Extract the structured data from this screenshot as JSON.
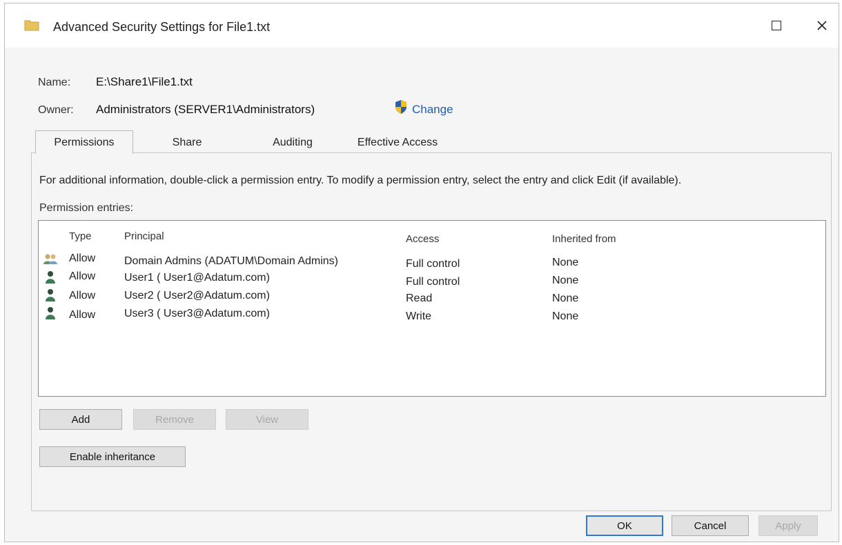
{
  "window": {
    "title": "Advanced Security Settings for File1.txt"
  },
  "fields": {
    "name_label": "Name:",
    "name_value": "E:\\Share1\\File1.txt",
    "owner_label": "Owner:",
    "owner_value": "Administrators (SERVER1\\Administrators)",
    "change_label": "Change"
  },
  "tabs": [
    {
      "label": "Permissions",
      "active": true
    },
    {
      "label": "Share"
    },
    {
      "label": "Auditing"
    },
    {
      "label": "Effective Access"
    }
  ],
  "info_text": "For additional information, double-click a permission entry. To modify a permission entry, select the entry and click Edit (if available).",
  "entries_label": "Permission entries:",
  "columns": {
    "type": "Type",
    "principal": "Principal",
    "access": "Access",
    "inherited": "Inherited from"
  },
  "entries": [
    {
      "icon": "group-users-icon",
      "type": "Allow",
      "principal": "Domain Admins (ADATUM\\Domain Admins)",
      "access": "Full control",
      "inherited": "None"
    },
    {
      "icon": "user-icon",
      "type": "Allow",
      "principal": "User1 ( User1@Adatum.com)",
      "access": "Full control",
      "inherited": "None"
    },
    {
      "icon": "user-icon",
      "type": "Allow",
      "principal": "User2 ( User2@Adatum.com)",
      "access": "Read",
      "inherited": "None"
    },
    {
      "icon": "user-icon",
      "type": "Allow",
      "principal": "User3 ( User3@Adatum.com)",
      "access": "Write",
      "inherited": "None"
    }
  ],
  "buttons": {
    "add": "Add",
    "remove": "Remove",
    "view": "View",
    "enable_inheritance": "Enable inheritance",
    "ok": "OK",
    "cancel": "Cancel",
    "apply": "Apply"
  },
  "colors": {
    "link": "#1a5fb4",
    "focus_border": "#2f7ad0",
    "folder": "#e8c25a"
  }
}
